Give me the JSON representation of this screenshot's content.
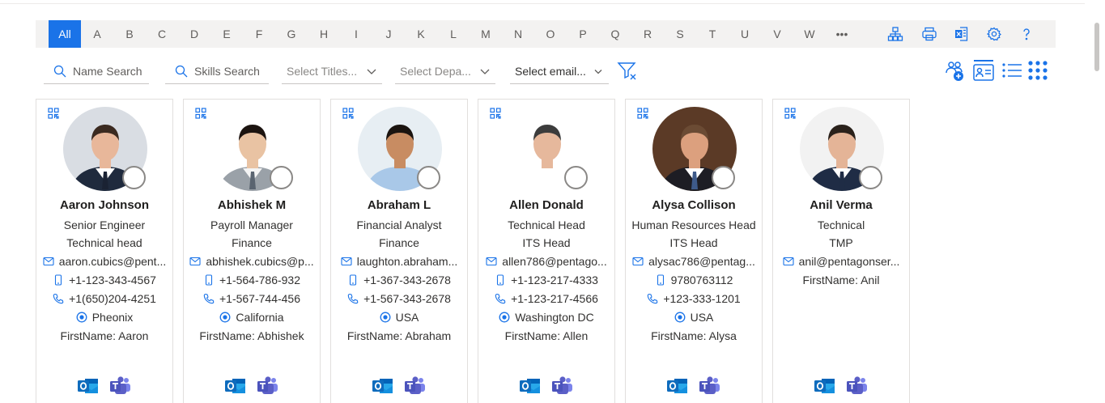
{
  "alphabet": {
    "items": [
      "All",
      "A",
      "B",
      "C",
      "D",
      "E",
      "F",
      "G",
      "H",
      "I",
      "J",
      "K",
      "L",
      "M",
      "N",
      "O",
      "P",
      "Q",
      "R",
      "S",
      "T",
      "U",
      "V",
      "W",
      "•••"
    ],
    "active": "All"
  },
  "toolbar_icons": [
    "org-chart-icon",
    "print-icon",
    "excel-export-icon",
    "settings-icon",
    "help-icon"
  ],
  "filters": {
    "name_search": "Name Search",
    "skills_search": "Skills Search",
    "titles_select": "Select Titles...",
    "departments_select": "Select Depa...",
    "email_select": "Select email..."
  },
  "view_icons": [
    "add-user-icon",
    "card-view-icon",
    "list-view-icon",
    "grid-view-icon"
  ],
  "colors": {
    "accent": "#1a73e8",
    "outlook": "#0f6cbd",
    "teams": "#5b5fc7"
  },
  "employees": [
    {
      "name": "Aaron Johnson",
      "title": "Senior Engineer",
      "department": "Technical head",
      "email": "aaron.cubics@pent...",
      "mobile": "+1-123-343-4567",
      "phone": "+1(650)204-4251",
      "location": "Pheonix",
      "firstname": "FirstName: Aaron"
    },
    {
      "name": "Abhishek M",
      "title": "Payroll Manager",
      "department": "Finance",
      "email": "abhishek.cubics@p...",
      "mobile": "+1-564-786-932",
      "phone": "+1-567-744-456",
      "location": "California",
      "firstname": "FirstName: Abhishek"
    },
    {
      "name": "Abraham L",
      "title": "Financial Analyst",
      "department": "Finance",
      "email": "laughton.abraham...",
      "mobile": "+1-367-343-2678",
      "phone": "+1-567-343-2678",
      "location": "USA",
      "firstname": "FirstName: Abraham"
    },
    {
      "name": "Allen Donald",
      "title": "Technical Head",
      "department": "ITS Head",
      "email": "allen786@pentago...",
      "mobile": "+1-123-217-4333",
      "phone": "+1-123-217-4566",
      "location": "Washington DC",
      "firstname": "FirstName: Allen"
    },
    {
      "name": "Alysa Collison",
      "title": "Human Resources Head",
      "department": "ITS Head",
      "email": "alysac786@pentag...",
      "mobile": "9780763112",
      "phone": "+123-333-1201",
      "location": "USA",
      "firstname": "FirstName: Alysa"
    },
    {
      "name": "Anil Verma",
      "title": "Technical",
      "department": "TMP",
      "email": "anil@pentagonser...",
      "firstname": "FirstName: Anil"
    }
  ]
}
